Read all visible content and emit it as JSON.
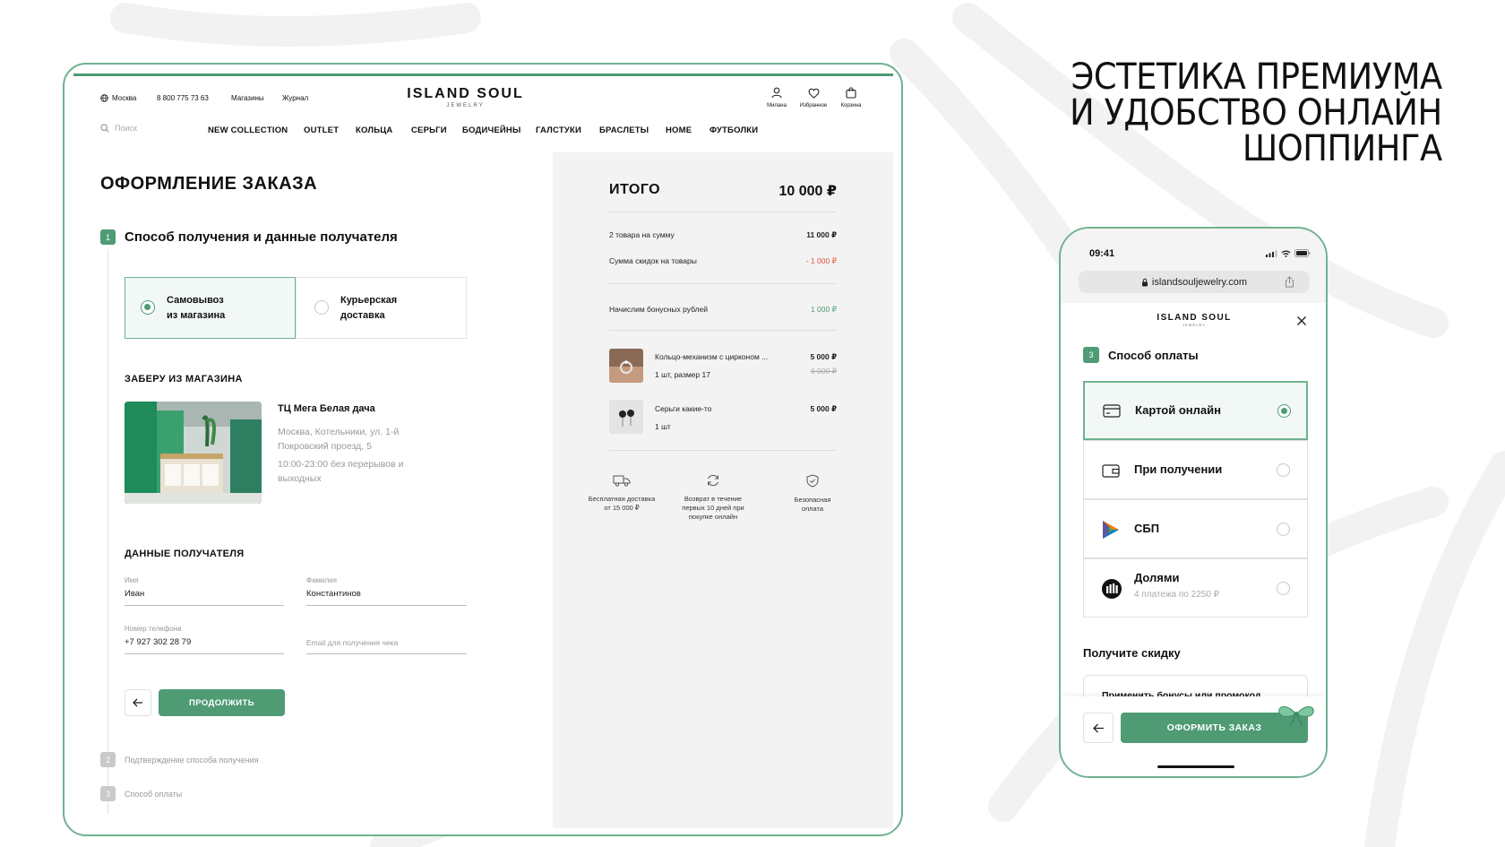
{
  "hero": {
    "lines": [
      "ЭСТЕТИКА ПРЕМИУМА",
      "И УДОБСТВО ОНЛАЙН",
      "ШОППИНГА"
    ]
  },
  "colors": {
    "accent": "#4e9b74",
    "accent_light": "#f2f8f5",
    "discount": "#e0533a",
    "bonus": "#4e9b74",
    "panel": "#f3f3f3"
  },
  "site": {
    "header": {
      "city": "Москва",
      "phone": "8 800 775 73 63",
      "links": [
        "Магазины",
        "Журнал"
      ],
      "logo": "ISLAND SOUL",
      "logo_sub": "JEWELRY",
      "icons": [
        {
          "name": "user-icon",
          "label": "Милана"
        },
        {
          "name": "heart-icon",
          "label": "Избранное"
        },
        {
          "name": "bag-icon",
          "label": "Корзина"
        }
      ],
      "search_placeholder": "Поиск",
      "nav": [
        "NEW COLLECTION",
        "OUTLET",
        "КОЛЬЦА",
        "СЕРЬГИ",
        "БОДИЧЕЙНЫ",
        "ГАЛСТУКИ",
        "БРАСЛЕТЫ",
        "HOME",
        "ФУТБОЛКИ"
      ]
    },
    "checkout": {
      "title": "ОФОРМЛЕНИЕ ЗАКАЗА",
      "step1": {
        "num": "1",
        "title": "Способ получения и данные получателя"
      },
      "delivery_options": [
        {
          "line1": "Самовывоз",
          "line2": "из магазина",
          "selected": true
        },
        {
          "line1": "Курьерская",
          "line2": "доставка",
          "selected": false
        }
      ],
      "pickup_title": "ЗАБЕРУ ИЗ МАГАЗИНА",
      "store": {
        "name": "ТЦ Мега Белая дача",
        "addr1": "Москва, Котельники, ул. 1-й",
        "addr2": "Покровский проезд, 5",
        "hours1": "10:00-23:00 без перерывов и",
        "hours2": "выходных"
      },
      "recipient_title": "ДАННЫЕ ПОЛУЧАТЕЛЯ",
      "fields": {
        "first_name": {
          "label": "Имя",
          "value": "Иван"
        },
        "last_name": {
          "label": "Фамилия",
          "value": "Константинов"
        },
        "phone": {
          "label": "Номер телефона",
          "value": "+7 927 302 28 79"
        },
        "email": {
          "placeholder": "Email для получения чека"
        }
      },
      "continue_label": "ПРОДОЛЖИТЬ",
      "step2": {
        "num": "2",
        "title": "Подтверждение способа получения"
      },
      "step3": {
        "num": "3",
        "title": "Способ оплаты"
      }
    },
    "summary": {
      "title": "ИТОГО",
      "total": "10 000 ₽",
      "rows": [
        {
          "label": "2 товара на сумму",
          "value": "11 000 ₽"
        },
        {
          "label": "Сумма скидок на товары",
          "value": "- 1 000 ₽"
        }
      ],
      "bonus": {
        "label": "Начислим бонусных рублей",
        "value": "1 000 ₽"
      },
      "items": [
        {
          "name": "Кольцо-механизм с цирконом ...",
          "meta": "1 шт, размер 17",
          "price": "5 000 ₽",
          "old_price": "6 000 ₽"
        },
        {
          "name": "Серьги какие-то",
          "meta": "1 шт",
          "price": "5 000 ₽",
          "old_price": ""
        }
      ],
      "benefits": [
        {
          "icon": "truck-icon",
          "line1": "Бесплатная доставка",
          "line2": "от 15 000 ₽",
          "line3": ""
        },
        {
          "icon": "refresh-icon",
          "line1": "Возврат в течение",
          "line2": "первых 10 дней при",
          "line3": "покупке онлайн"
        },
        {
          "icon": "shield-icon",
          "line1": "Безопасная",
          "line2": "оплата",
          "line3": ""
        }
      ]
    }
  },
  "phone": {
    "time": "09:41",
    "url": "islandsouljewelry.com",
    "logo": "ISLAND SOUL",
    "logo_sub": "JEWELRY",
    "step": {
      "num": "3",
      "title": "Способ оплаты"
    },
    "payment_options": [
      {
        "icon": "card-icon",
        "label": "Картой онлайн",
        "sub": "",
        "selected": true
      },
      {
        "icon": "wallet-icon",
        "label": "При получении",
        "sub": "",
        "selected": false
      },
      {
        "icon": "sbp-icon",
        "label": "СБП",
        "sub": "",
        "selected": false
      },
      {
        "icon": "dolyami-icon",
        "label": "Долями",
        "sub": "4 платежа по 2250 ₽",
        "selected": false
      }
    ],
    "discount_title": "Получите скидку",
    "promo_label": "Применить бонусы или промокод",
    "order_label": "ОФОРМИТЬ ЗАКАЗ"
  }
}
